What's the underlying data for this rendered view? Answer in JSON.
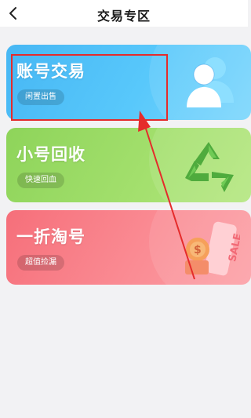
{
  "header": {
    "title": "交易专区",
    "back_icon": "chevron-left-icon"
  },
  "cards": [
    {
      "title": "账号交易",
      "badge": "闲置出售",
      "icon": "users-icon",
      "color": "#58c8fb"
    },
    {
      "title": "小号回收",
      "badge": "快速回血",
      "icon": "recycle-icon",
      "color": "#a2df6c"
    },
    {
      "title": "一折淘号",
      "badge": "超值捡漏",
      "icon": "sale-tag-icon",
      "color": "#fa8b93"
    }
  ],
  "annotation": {
    "highlight_color": "#e52b2b"
  }
}
